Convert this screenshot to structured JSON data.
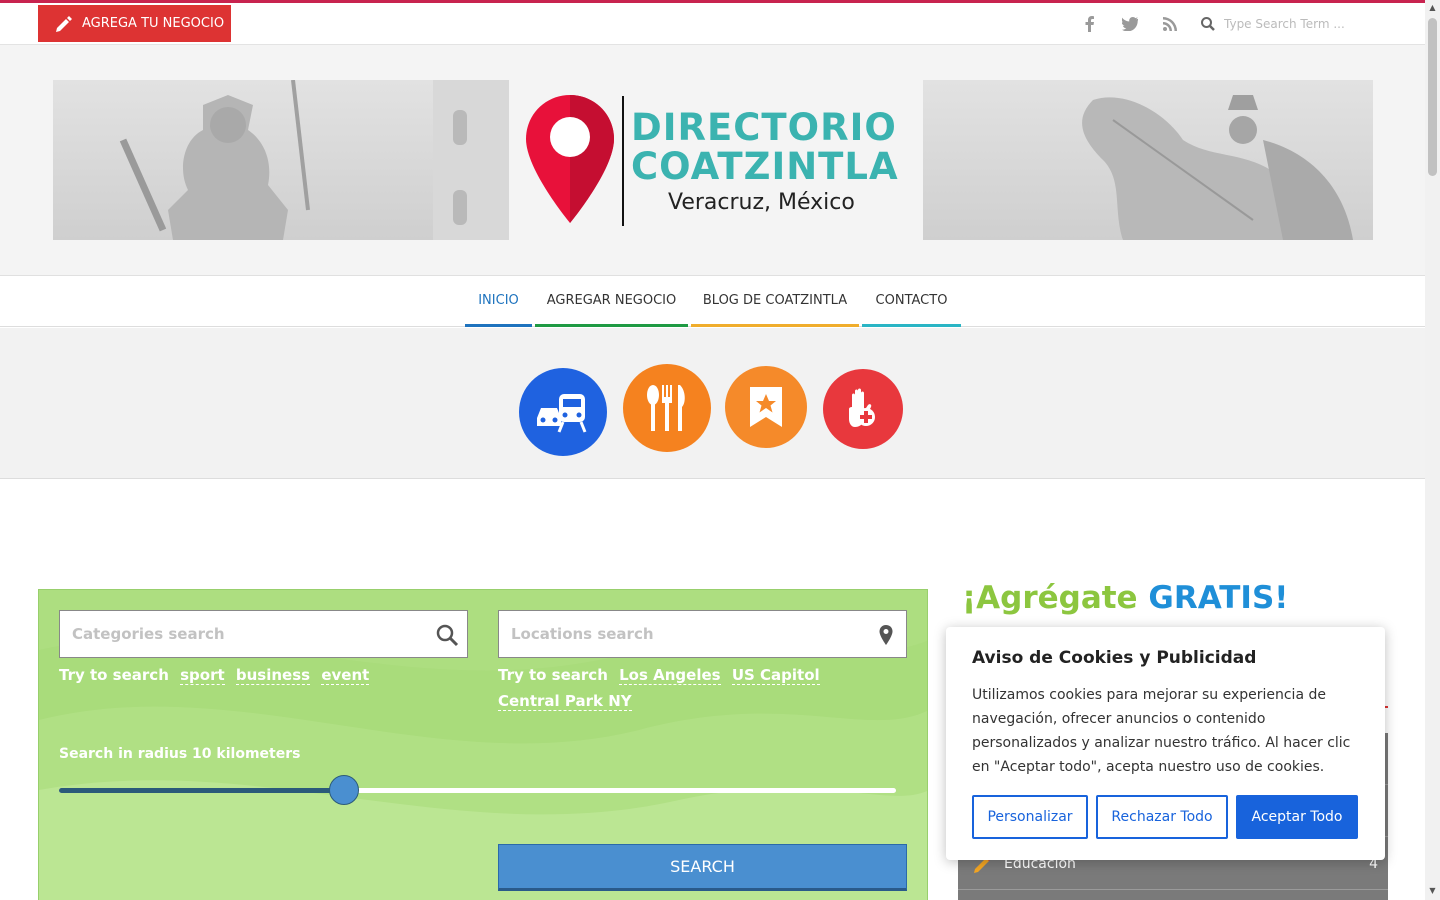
{
  "topbar": {
    "add_business_label": "AGREGA TU NEGOCIO",
    "search_placeholder": "Type Search Term ...",
    "social_icons": [
      "facebook-icon",
      "twitter-icon",
      "rss-icon"
    ]
  },
  "logo": {
    "line1": "DIRECTORIO",
    "line2": "COATZINTLA",
    "subtitle": "Veracruz, México",
    "pin_color": "#e8113a",
    "text_color": "#3bb3b0"
  },
  "nav": {
    "items": [
      {
        "label": "INICIO",
        "color": "#1e73be",
        "active": true
      },
      {
        "label": "AGREGAR NEGOCIO",
        "color": "#1f9a43"
      },
      {
        "label": "BLOG DE COATZINTLA",
        "color": "#f0ad2c"
      },
      {
        "label": "CONTACTO",
        "color": "#2ab5c5"
      }
    ]
  },
  "categories": [
    {
      "icon": "car-train-icon",
      "color": "#1f62e0"
    },
    {
      "icon": "restaurant-icon",
      "color": "#f5821f"
    },
    {
      "icon": "bookmark-star-icon",
      "color": "#f58a2a"
    },
    {
      "icon": "health-hand-icon",
      "color": "#e8383d"
    }
  ],
  "search": {
    "categories_placeholder": "Categories search",
    "locations_placeholder": "Locations search",
    "try_label": "Try to search",
    "category_suggestions": [
      "sport",
      "business",
      "event"
    ],
    "location_suggestions_row1": [
      "Los Angeles",
      "US Capitol"
    ],
    "location_suggestions_row2": [
      "Central Park NY"
    ],
    "radius_label": "Search in radius 10 kilometers",
    "radius_fraction": 0.34,
    "search_button": "SEARCH"
  },
  "sidebar": {
    "title_part1": "¡Agrégate",
    "title_part2": "GRATIS!",
    "visible_item": "Educación",
    "visible_item_count": "4"
  },
  "cookie": {
    "title": "Aviso de Cookies y Publicidad",
    "text": "Utilizamos cookies para mejorar su experiencia de navegación, ofrecer anuncios o contenido personalizados y analizar nuestro tráfico. Al hacer clic en \"Aceptar todo\", acepta nuestro uso de cookies.",
    "customize": "Personalizar",
    "reject": "Rechazar Todo",
    "accept": "Aceptar Todo",
    "accent": "#1863dc"
  }
}
